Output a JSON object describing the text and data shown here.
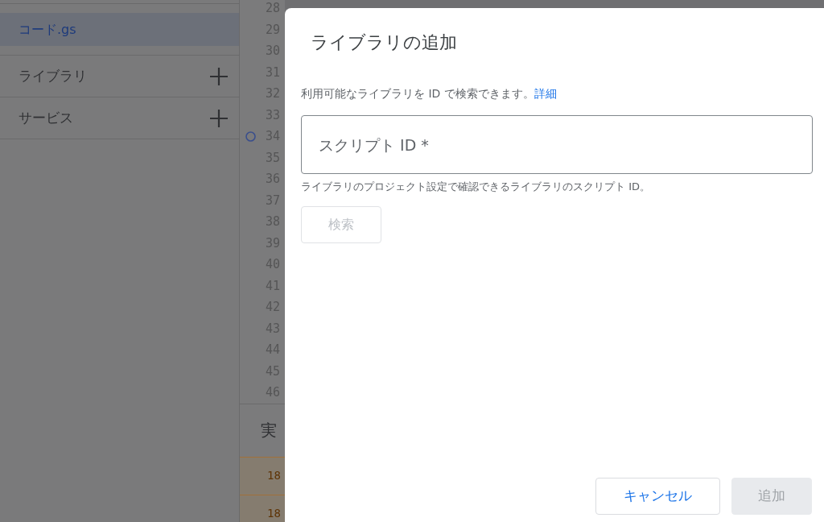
{
  "sidebar": {
    "files": [
      {
        "name": "コード.gs",
        "selected": true
      }
    ],
    "sections": [
      {
        "label": "ライブラリ"
      },
      {
        "label": "サービス"
      }
    ]
  },
  "editor": {
    "lines": [
      {
        "number": "28",
        "breakpoint": false
      },
      {
        "number": "29",
        "breakpoint": false
      },
      {
        "number": "30",
        "breakpoint": false
      },
      {
        "number": "31",
        "breakpoint": false
      },
      {
        "number": "32",
        "breakpoint": false
      },
      {
        "number": "33",
        "breakpoint": false
      },
      {
        "number": "34",
        "breakpoint": true
      },
      {
        "number": "35",
        "breakpoint": false
      },
      {
        "number": "36",
        "breakpoint": false
      },
      {
        "number": "37",
        "breakpoint": false
      },
      {
        "number": "38",
        "breakpoint": false
      },
      {
        "number": "39",
        "breakpoint": false
      },
      {
        "number": "40",
        "breakpoint": false
      },
      {
        "number": "41",
        "breakpoint": false
      },
      {
        "number": "42",
        "breakpoint": false
      },
      {
        "number": "43",
        "breakpoint": false
      },
      {
        "number": "44",
        "breakpoint": false
      },
      {
        "number": "45",
        "breakpoint": false
      },
      {
        "number": "46",
        "breakpoint": false
      }
    ]
  },
  "output_panel": {
    "title": "実",
    "rows": [
      {
        "text": "18"
      },
      {
        "text": "18"
      }
    ]
  },
  "dialog": {
    "title": "ライブラリの追加",
    "description": "利用可能なライブラリを ID で検索できます。",
    "link": "詳細",
    "field": {
      "placeholder": "スクリプト ID *",
      "helper": "ライブラリのプロジェクト設定で確認できるライブラリのスクリプト ID。"
    },
    "search_button": {
      "label": "検索",
      "disabled": true
    },
    "buttons": [
      {
        "label": "キャンセル",
        "disabled": false
      },
      {
        "label": "追加",
        "disabled": true
      }
    ]
  }
}
